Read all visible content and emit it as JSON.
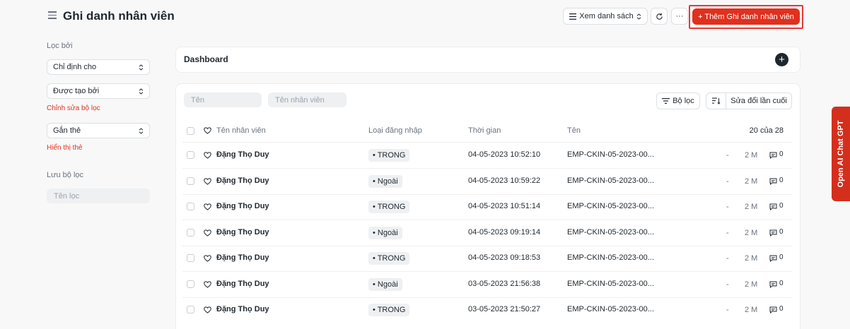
{
  "header": {
    "title": "Ghi danh nhân viên",
    "view_list_label": "Xem danh sách",
    "more_label": "···",
    "add_label": "+ Thêm Ghi danh nhân viên"
  },
  "sidebar": {
    "filter_by_label": "Lọc bởi",
    "assigned_to": "Chỉ định cho",
    "created_by": "Được tạo bởi",
    "edit_filters": "Chỉnh sửa bộ lọc",
    "tagged": "Gắn thẻ",
    "show_tags": "Hiển thị thẻ",
    "save_filter_label": "Lưu bộ lọc",
    "filter_name_placeholder": "Tên lọc"
  },
  "dashboard": {
    "title": "Dashboard"
  },
  "list": {
    "name_placeholder": "Tên",
    "employee_name_placeholder": "Tên nhân viên",
    "filter_button": "Bộ lọc",
    "sort_label": "Sửa đổi lần cuối",
    "columns": {
      "employee_name": "Tên nhân viên",
      "log_type": "Loại đăng nhập",
      "time": "Thời gian",
      "name": "Tên",
      "count": "20 của 28"
    },
    "rows": [
      {
        "employee": "Đặng Thọ Duy",
        "log_type": "• TRONG",
        "time": "04-05-2023 10:52:10",
        "name": "EMP-CKIN-05-2023-00...",
        "dash": "-",
        "modified": "2 M",
        "comments": "0"
      },
      {
        "employee": "Đặng Thọ Duy",
        "log_type": "• Ngoài",
        "time": "04-05-2023 10:59:22",
        "name": "EMP-CKIN-05-2023-00...",
        "dash": "-",
        "modified": "2 M",
        "comments": "0"
      },
      {
        "employee": "Đặng Thọ Duy",
        "log_type": "• TRONG",
        "time": "04-05-2023 10:51:14",
        "name": "EMP-CKIN-05-2023-00...",
        "dash": "-",
        "modified": "2 M",
        "comments": "0"
      },
      {
        "employee": "Đặng Thọ Duy",
        "log_type": "• Ngoài",
        "time": "04-05-2023 09:19:14",
        "name": "EMP-CKIN-05-2023-00...",
        "dash": "-",
        "modified": "2 M",
        "comments": "0"
      },
      {
        "employee": "Đặng Thọ Duy",
        "log_type": "• TRONG",
        "time": "04-05-2023 09:18:53",
        "name": "EMP-CKIN-05-2023-00...",
        "dash": "-",
        "modified": "2 M",
        "comments": "0"
      },
      {
        "employee": "Đặng Thọ Duy",
        "log_type": "• Ngoài",
        "time": "03-05-2023 21:56:38",
        "name": "EMP-CKIN-05-2023-00...",
        "dash": "-",
        "modified": "2 M",
        "comments": "0"
      },
      {
        "employee": "Đặng Thọ Duy",
        "log_type": "• TRONG",
        "time": "03-05-2023 21:50:27",
        "name": "EMP-CKIN-05-2023-00...",
        "dash": "-",
        "modified": "2 M",
        "comments": "0"
      }
    ]
  },
  "side_tab": {
    "label": "Open AI Chat GPT"
  }
}
